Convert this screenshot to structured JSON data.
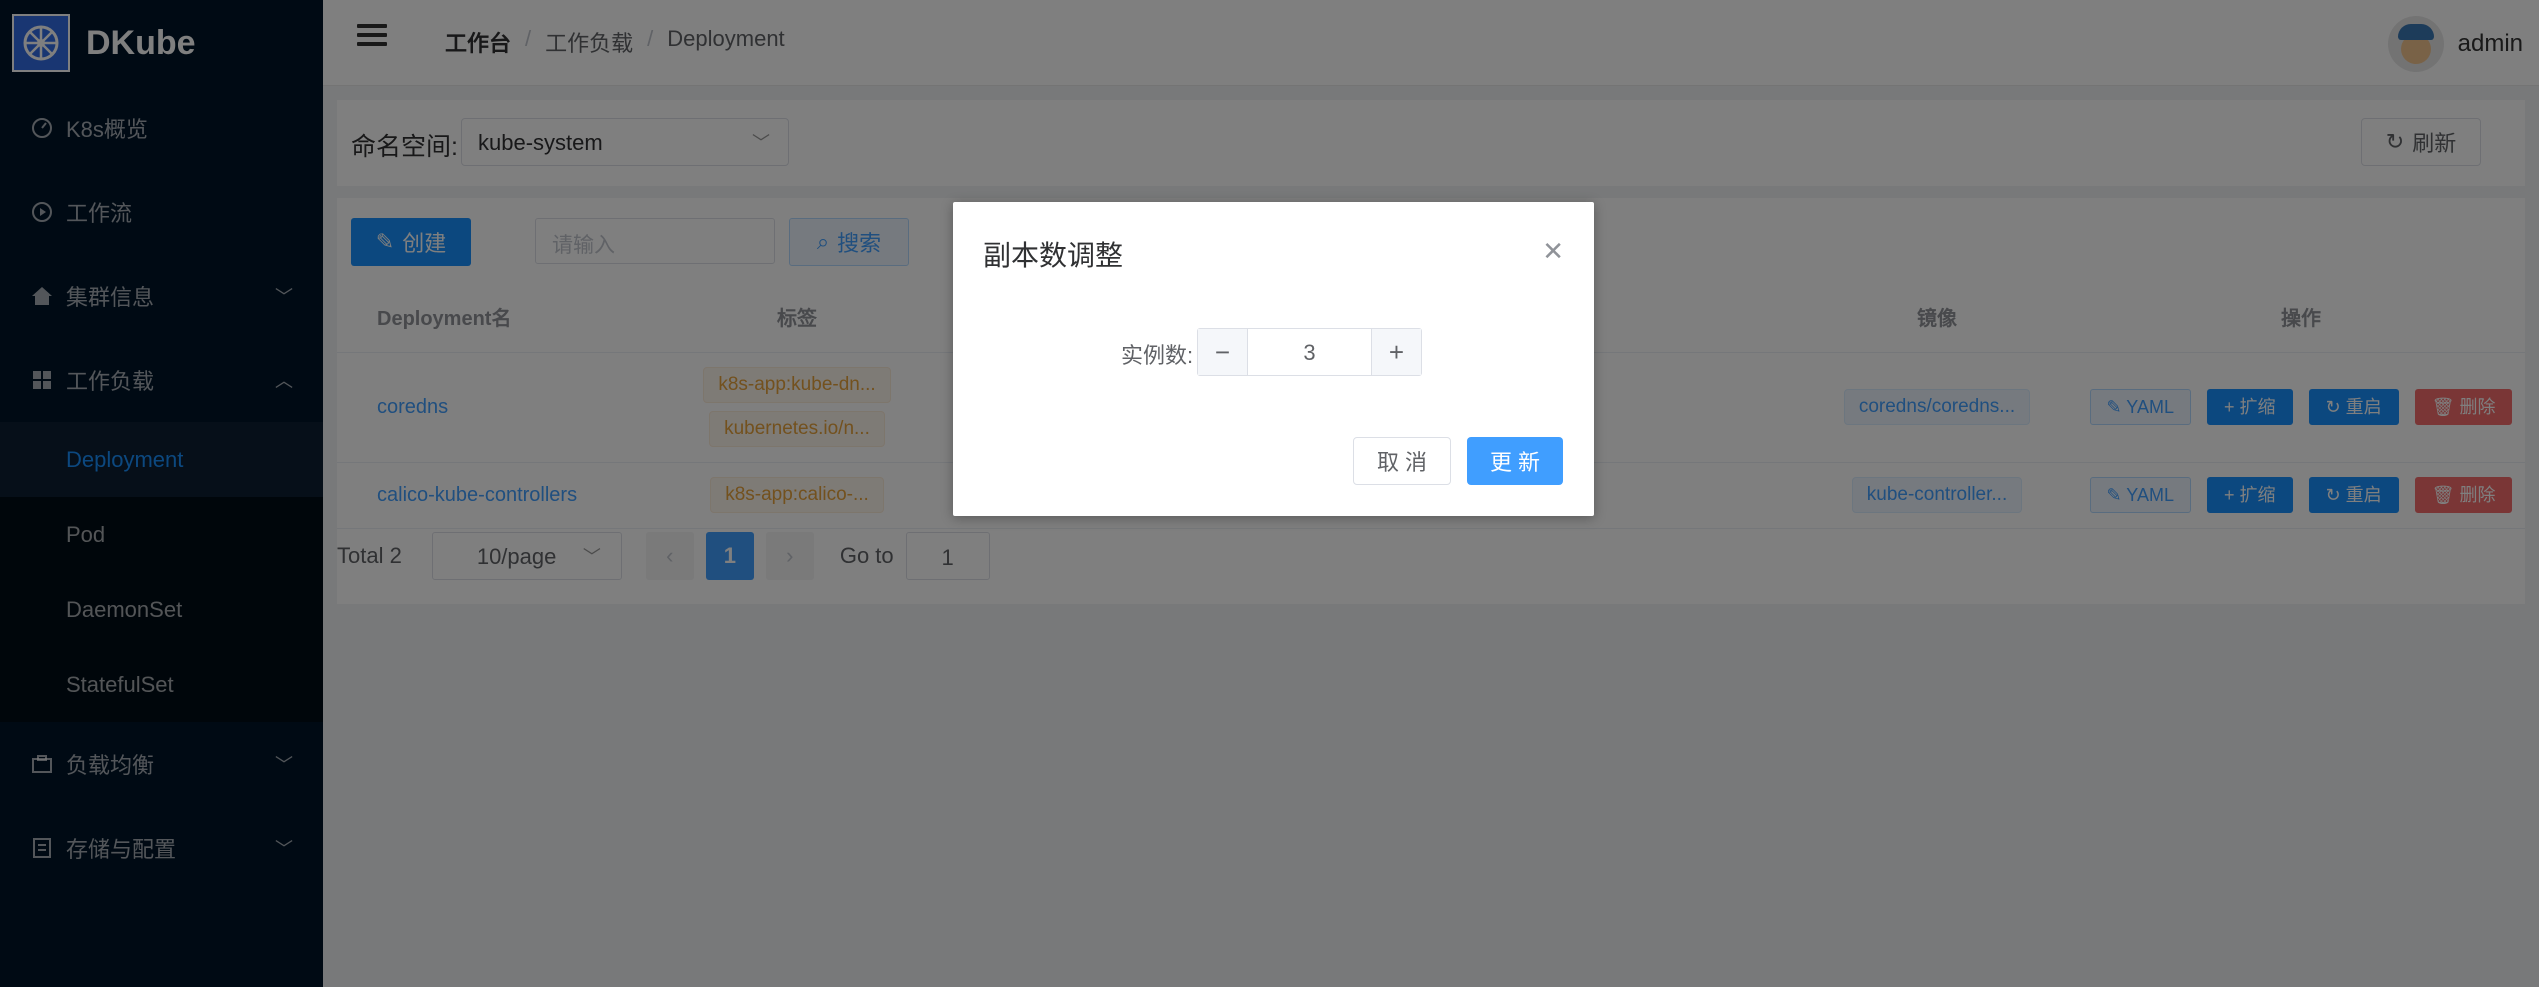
{
  "app": {
    "title": "DKube"
  },
  "sidebar": {
    "items": [
      {
        "label": "K8s概览",
        "icon": "gauge-icon"
      },
      {
        "label": "工作流",
        "icon": "play-circle-icon"
      },
      {
        "label": "集群信息",
        "icon": "home-icon"
      },
      {
        "label": "工作负载",
        "icon": "grid-icon"
      }
    ],
    "subitems": [
      "Deployment",
      "Pod",
      "DaemonSet",
      "StatefulSet"
    ],
    "items_bottom": [
      {
        "label": "负载均衡",
        "icon": "briefcase-icon"
      },
      {
        "label": "存储与配置",
        "icon": "document-icon"
      }
    ],
    "active": "Deployment"
  },
  "header": {
    "breadcrumb": [
      "工作台",
      "工作负载",
      "Deployment"
    ],
    "username": "admin"
  },
  "namespace": {
    "label": "命名空间:",
    "value": "kube-system",
    "refresh_label": "刷新"
  },
  "toolbar": {
    "create_label": "创建",
    "search_placeholder": "请输入",
    "search_label": "搜索"
  },
  "table": {
    "columns": [
      "Deployment名",
      "标签",
      "镜像",
      "操作"
    ],
    "rows": [
      {
        "name": "coredns",
        "labels": [
          "k8s-app:kube-dn...",
          "kubernetes.io/n..."
        ],
        "image": "coredns/coredns..."
      },
      {
        "name": "calico-kube-controllers",
        "labels": [
          "k8s-app:calico-..."
        ],
        "image": "kube-controller..."
      }
    ],
    "ops": {
      "yaml": "YAML",
      "scale": "扩缩",
      "restart": "重启",
      "delete": "删除"
    }
  },
  "pagination": {
    "total": "Total 2",
    "page_size": "10/page",
    "current": "1",
    "goto_label": "Go to",
    "goto_value": "1"
  },
  "dialog": {
    "title": "副本数调整",
    "field_label": "实例数:",
    "value": "3",
    "cancel_label": "取 消",
    "update_label": "更 新"
  },
  "colors": {
    "primary": "#409eff",
    "sidebar": "#001529",
    "danger": "#f56c6c",
    "warning": "#e6a23c"
  }
}
